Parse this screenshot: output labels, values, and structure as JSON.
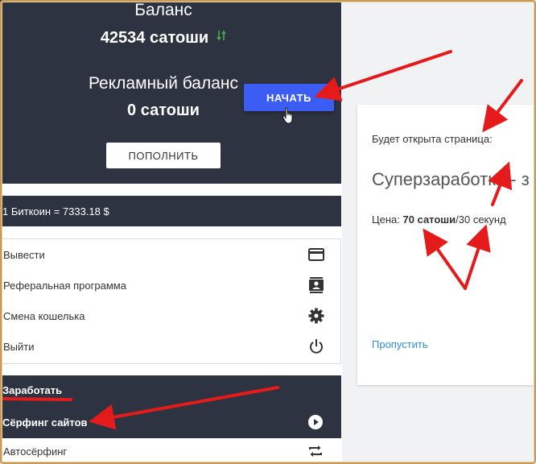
{
  "balance": {
    "title": "Баланс",
    "value": "42534 сатоши",
    "ad_title": "Рекламный баланс",
    "ad_value": "0 сатоши",
    "start_label": "НАЧАТЬ",
    "topup_label": "ПОПОЛНИТЬ"
  },
  "rate": {
    "text": "1 Биткоин = 7333.18 $"
  },
  "menu": {
    "items": [
      {
        "label": "Вывести",
        "icon": "credit-card-icon"
      },
      {
        "label": "Реферальная программа",
        "icon": "contacts-icon"
      },
      {
        "label": "Смена кошелька",
        "icon": "gear-icon"
      },
      {
        "label": "Выйти",
        "icon": "power-icon"
      }
    ]
  },
  "earn": {
    "header": "Заработать",
    "surf_label": "Сёрфинг сайтов",
    "autosurf_label": "Автосёрфинг"
  },
  "info": {
    "label": "Будет открыта страница:",
    "site": "Суперзаработки - з",
    "price_prefix": "Цена: ",
    "price_value": "70 сатоши",
    "price_suffix": "/30 секунд",
    "skip_label": "Пропустить"
  },
  "colors": {
    "dark_panel": "#2e3341",
    "accent_button": "#3c5df4",
    "link": "#2f8fcf",
    "annotation": "#e51b1b",
    "frame": "#c99a55"
  }
}
